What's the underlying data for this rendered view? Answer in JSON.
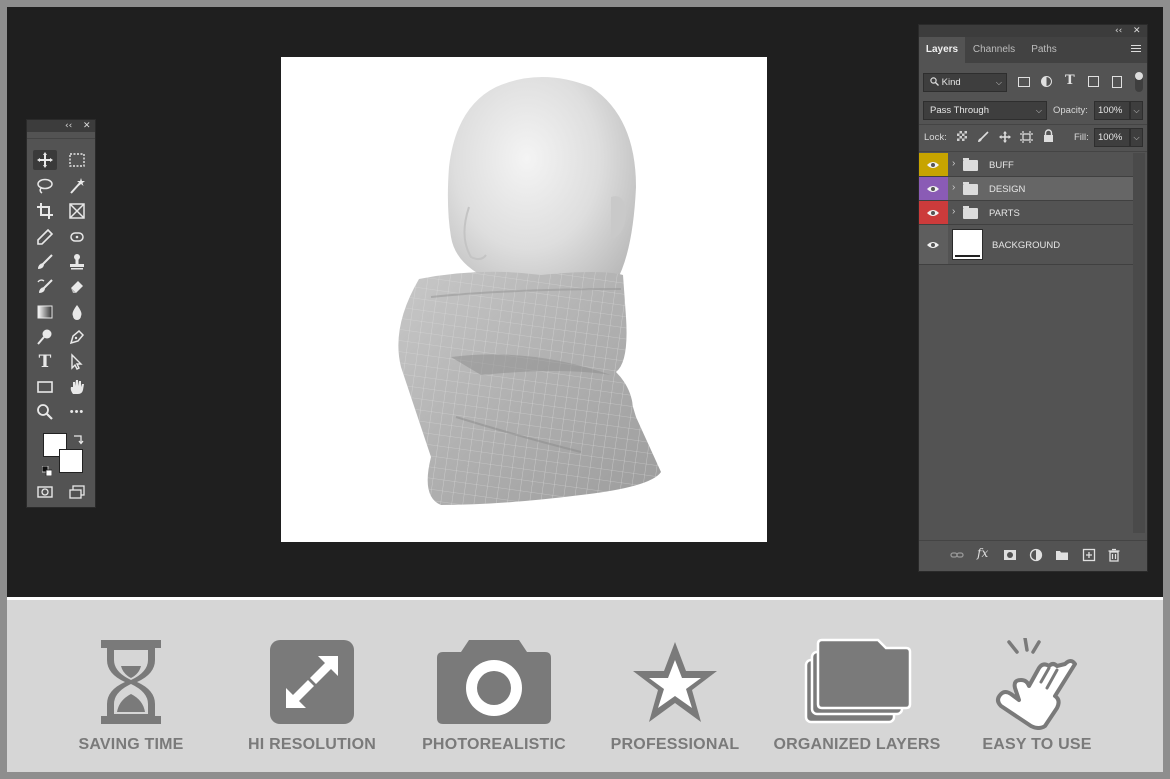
{
  "toolbox": {
    "header_collapse": "‹‹",
    "header_close": "✕",
    "tools": [
      "move-tool",
      "rectangular-marquee-tool",
      "lasso-tool",
      "magic-wand-tool",
      "crop-tool",
      "frame-tool",
      "eyedropper-tool",
      "spot-healing-tool",
      "brush-tool",
      "clone-stamp-tool",
      "history-brush-tool",
      "eraser-tool",
      "gradient-tool",
      "blur-tool",
      "dodge-tool",
      "pen-tool",
      "type-tool",
      "path-selection-tool",
      "rectangle-tool",
      "hand-tool",
      "zoom-tool",
      "more-tools",
      "foreground-background-colors",
      "quick-mask",
      "screen-mode"
    ],
    "text_tool_glyph": "T",
    "more_glyph": "•••"
  },
  "layers_panel": {
    "collapse": "‹‹",
    "close": "✕",
    "tabs": [
      "Layers",
      "Channels",
      "Paths"
    ],
    "active_tab": "Layers",
    "filter_kind": "Kind",
    "blend_mode": "Pass Through",
    "opacity_label": "Opacity:",
    "opacity_value": "100%",
    "lock_label": "Lock:",
    "fill_label": "Fill:",
    "fill_value": "100%",
    "layers": [
      {
        "name": "BUFF",
        "type": "group",
        "eye_color": "#c7a400"
      },
      {
        "name": "DESIGN",
        "type": "group",
        "eye_color": "#8a5bb5"
      },
      {
        "name": "PARTS",
        "type": "group",
        "eye_color": "#cc3b3b"
      },
      {
        "name": "BACKGROUND",
        "type": "layer",
        "eye_color": "#5e5e5e"
      }
    ],
    "selected_layer": "DESIGN"
  },
  "features": [
    {
      "label": "SAVING TIME",
      "icon": "hourglass-icon"
    },
    {
      "label": "HI RESOLUTION",
      "icon": "expand-icon"
    },
    {
      "label": "PHOTOREALISTIC",
      "icon": "camera-icon"
    },
    {
      "label": "PROFESSIONAL",
      "icon": "star-icon"
    },
    {
      "label": "ORGANIZED LAYERS",
      "icon": "folders-icon"
    },
    {
      "label": "EASY TO USE",
      "icon": "pointing-hand-icon"
    }
  ],
  "colors": {
    "workspace": "#1f1f1f",
    "panel": "#535353",
    "feature_icon": "#7a7a7a",
    "band": "#d6d6d6"
  }
}
